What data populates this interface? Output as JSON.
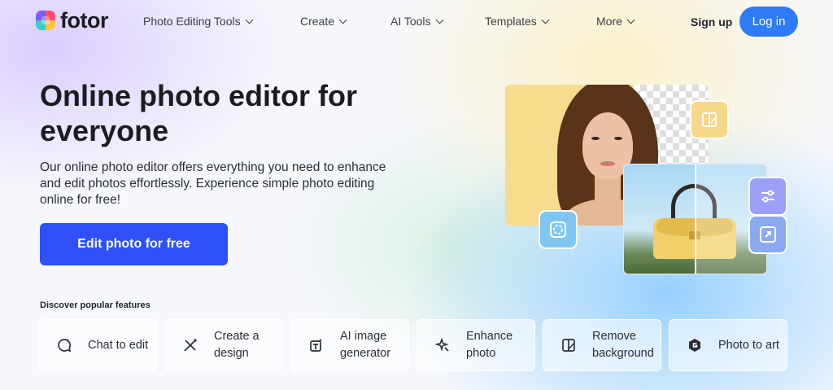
{
  "brand": {
    "name": "fotor"
  },
  "nav": {
    "items": [
      {
        "label": "Photo Editing Tools"
      },
      {
        "label": "Create"
      },
      {
        "label": "AI Tools"
      },
      {
        "label": "Templates"
      },
      {
        "label": "More"
      }
    ],
    "signup": "Sign up",
    "login": "Log in"
  },
  "hero": {
    "title": "Online photo editor for everyone",
    "subtitle": "Our online photo editor offers everything you need to enhance and edit photos effortlessly. Experience simple photo editing online for free!",
    "cta": "Edit photo for free"
  },
  "features": {
    "heading": "Discover popular features",
    "items": [
      {
        "label": "Chat to edit",
        "icon": "chat-sparkle-icon"
      },
      {
        "label": "Create a design",
        "icon": "design-tools-icon"
      },
      {
        "label": "AI image generator",
        "icon": "ai-text-image-icon"
      },
      {
        "label": "Enhance photo",
        "icon": "enhance-sparkle-icon"
      },
      {
        "label": "Remove background",
        "icon": "remove-background-icon"
      },
      {
        "label": "Photo to art",
        "icon": "photo-to-art-icon"
      }
    ]
  },
  "colors": {
    "login_button": "#2f7bf5",
    "cta_button": "#2e50f6"
  }
}
